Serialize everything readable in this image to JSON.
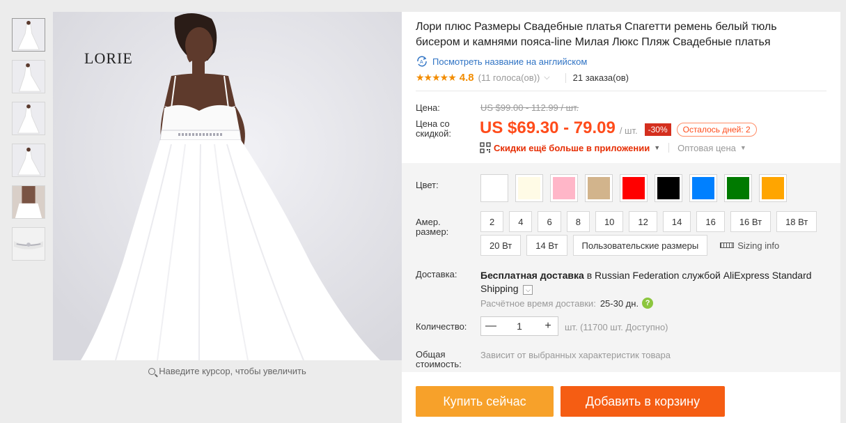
{
  "gallery": {
    "brand_logo": "LORIE",
    "zoom_hint": "Наведите курсор, чтобы увеличить",
    "thumbnail_count": 6
  },
  "product": {
    "title": "Лори плюс Размеры Свадебные платья Спагетти ремень белый тюль бисером и камнями пояса-line Милая Люкс Пляж Свадебные платья",
    "translate_link": "Посмотреть название на английском",
    "stars": "★★★★★",
    "rating": "4.8",
    "votes": "(11 голоса(ов))",
    "orders": "21 заказа(ов)"
  },
  "price": {
    "label": "Цена:",
    "old": "US $99.00 - 112.99 / шт.",
    "discount_label": "Цена со скидкой:",
    "new": "US $69.30 - 79.09",
    "unit": "/ шт.",
    "discount_badge": "-30%",
    "days_left": "Осталось дней: 2",
    "app_offer": "Скидки ещё больше в приложении",
    "wholesale": "Оптовая цена"
  },
  "color": {
    "label": "Цвет:",
    "swatches": [
      "#ffffff",
      "#fffbe6",
      "#ffb6c8",
      "#d2b48c",
      "#ff0000",
      "#000000",
      "#0080ff",
      "#007a00",
      "#ffa500"
    ]
  },
  "size": {
    "label": "Амер. размер:",
    "options": [
      "2",
      "4",
      "6",
      "8",
      "10",
      "12",
      "14",
      "16",
      "16 Вт",
      "18 Вт",
      "20 Вт",
      "14 Вт",
      "Пользовательские размеры"
    ],
    "sizing_info": "Sizing info"
  },
  "delivery": {
    "label": "Доставка:",
    "free": "Бесплатная доставка",
    "to": "в Russian Federation службой AliExpress Standard Shipping",
    "est_label": "Расчётное время доставки:",
    "est_days": "25-30 дн."
  },
  "quantity": {
    "label": "Количество:",
    "minus": "—",
    "value": "1",
    "plus": "+",
    "available": "шт. (11700 шт. Доступно)"
  },
  "total": {
    "label": "Общая стоимость:",
    "note": "Зависит от выбранных характеристик товара"
  },
  "actions": {
    "buy_now": "Купить сейчас",
    "add_to_cart": "Добавить в корзину"
  }
}
